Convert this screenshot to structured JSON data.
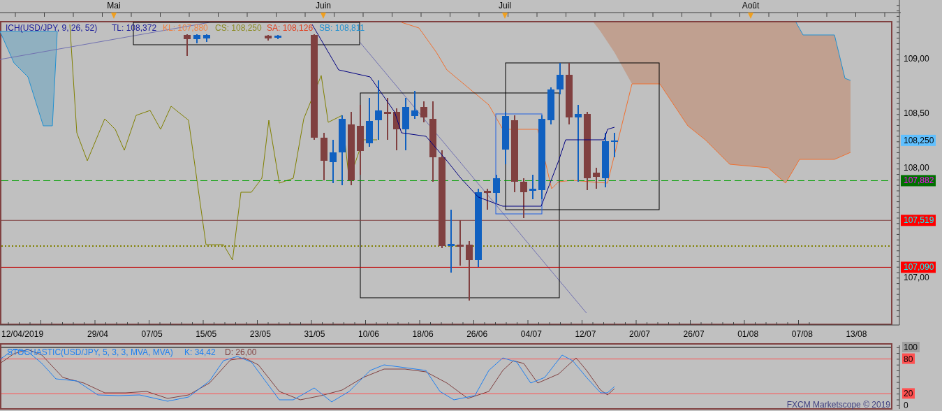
{
  "time_axis": {
    "months": [
      "Mai",
      "Juin",
      "Juil",
      "Août"
    ],
    "dates": [
      "12/04/2019",
      "29/04",
      "07/05",
      "15/05",
      "23/05",
      "31/05",
      "10/06",
      "18/06",
      "26/06",
      "04/07",
      "12/07",
      "20/07",
      "26/07",
      "01/08",
      "07/08",
      "13/08"
    ]
  },
  "price_chart": {
    "legend": [
      {
        "text": "ICH(USD/JPY, 9, 26, 52)",
        "kind": "name"
      },
      {
        "text": "TL: 108,372",
        "kind": "tl"
      },
      {
        "text": "KL: 107,880",
        "kind": "kl"
      },
      {
        "text": "CS: 108,250",
        "kind": "cs"
      },
      {
        "text": "SA: 108,126",
        "kind": "sa"
      },
      {
        "text": "SB: 108,811",
        "kind": "sb"
      }
    ],
    "price_labels": [
      {
        "text": "109,00",
        "kind": "tick"
      },
      {
        "text": "108,50",
        "kind": "tick"
      },
      {
        "text": "108,250",
        "kind": "last"
      },
      {
        "text": "108,00",
        "kind": "tick"
      },
      {
        "text": "107,882",
        "kind": "green"
      },
      {
        "text": "107,519",
        "kind": "red"
      },
      {
        "text": "107,090",
        "kind": "red"
      },
      {
        "text": "107,00",
        "kind": "tick"
      }
    ]
  },
  "stochastic": {
    "legend": [
      {
        "text": "STOCHASTIC(USD/JPY, 5, 3, 3, MVA, MVA)",
        "kind": "name"
      },
      {
        "text": "K: 34,42",
        "kind": "k"
      },
      {
        "text": "D: 26,00",
        "kind": "d"
      }
    ],
    "scale_labels": [
      {
        "text": "100",
        "kind": "max"
      },
      {
        "text": "80",
        "kind": "level"
      },
      {
        "text": "20",
        "kind": "level"
      },
      {
        "text": "0",
        "kind": "tick"
      }
    ],
    "footer": "FXCM Marketscope © 2019"
  }
}
